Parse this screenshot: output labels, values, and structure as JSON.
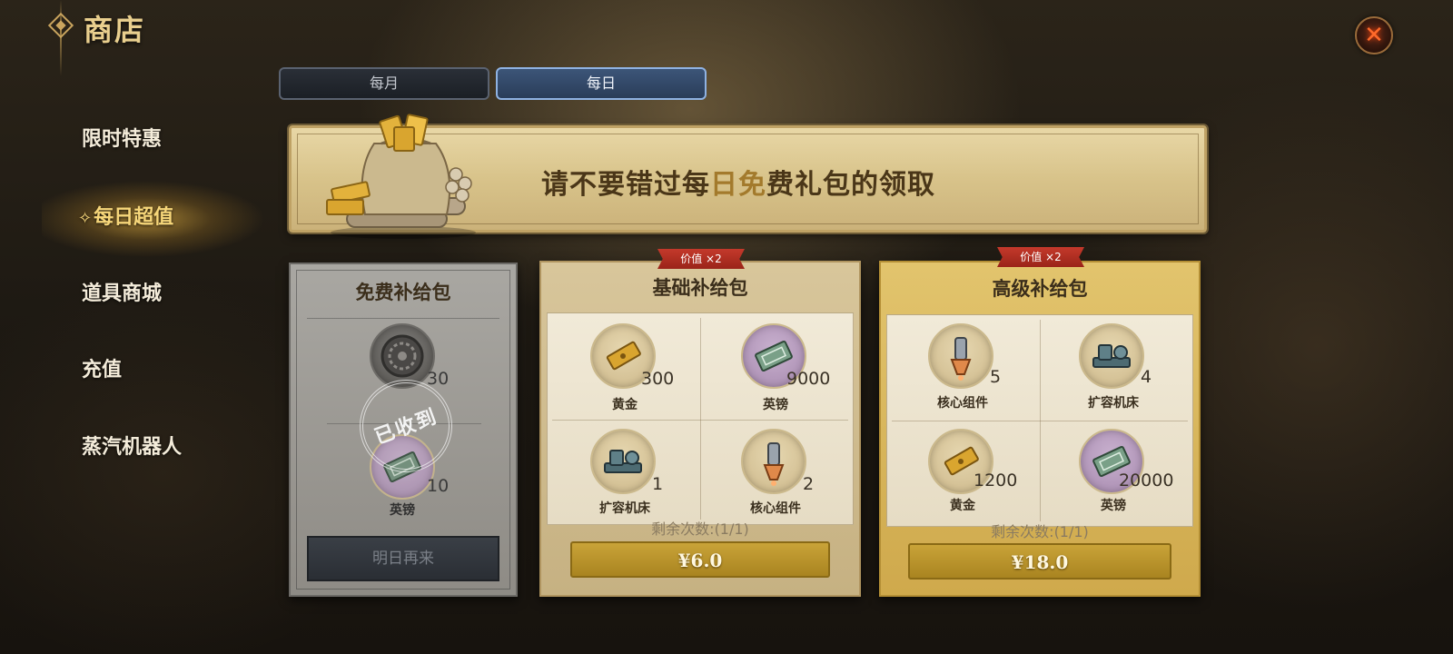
{
  "header": {
    "title": "商店"
  },
  "sidebar": {
    "items": [
      {
        "label": "限时特惠"
      },
      {
        "label": "每日超值"
      },
      {
        "label": "道具商城"
      },
      {
        "label": "充值"
      },
      {
        "label": "蒸汽机器人"
      }
    ],
    "active_index": 1
  },
  "tabs": [
    {
      "label": "每月",
      "selected": false
    },
    {
      "label": "每日",
      "selected": true
    }
  ],
  "banner": {
    "text_a": "请不要错过每",
    "text_b": "日免",
    "text_c": "费礼包的领取"
  },
  "packs": {
    "free": {
      "title": "免费补给包",
      "items": [
        {
          "name": "",
          "qty": "30",
          "icon": "gear-medal-icon"
        },
        {
          "name": "英镑",
          "qty": "10",
          "icon": "banknote-icon"
        }
      ],
      "stamp": "已收到",
      "button": "明日再来"
    },
    "basic": {
      "ribbon": "价值 ×2",
      "title": "基础补给包",
      "items": [
        {
          "name": "黄金",
          "qty": "300",
          "icon": "gold-bar-icon"
        },
        {
          "name": "英镑",
          "qty": "9000",
          "icon": "banknote-icon"
        },
        {
          "name": "扩容机床",
          "qty": "1",
          "icon": "machine-tool-icon"
        },
        {
          "name": "核心组件",
          "qty": "2",
          "icon": "core-component-icon"
        }
      ],
      "remaining": "剩余次数:(1/1)",
      "price": "¥6.0"
    },
    "advanced": {
      "ribbon": "价值 ×2",
      "title": "高级补给包",
      "items": [
        {
          "name": "核心组件",
          "qty": "5",
          "icon": "core-component-icon"
        },
        {
          "name": "扩容机床",
          "qty": "4",
          "icon": "machine-tool-icon"
        },
        {
          "name": "黄金",
          "qty": "1200",
          "icon": "gold-bar-icon"
        },
        {
          "name": "英镑",
          "qty": "20000",
          "icon": "banknote-icon"
        }
      ],
      "remaining": "剩余次数:(1/1)",
      "price": "¥18.0"
    }
  },
  "colors": {
    "accent_gold": "#f7d77a",
    "tab_selected": "#3c5578",
    "ribbon_red": "#c4392b",
    "button_gold": "#c9a338"
  }
}
